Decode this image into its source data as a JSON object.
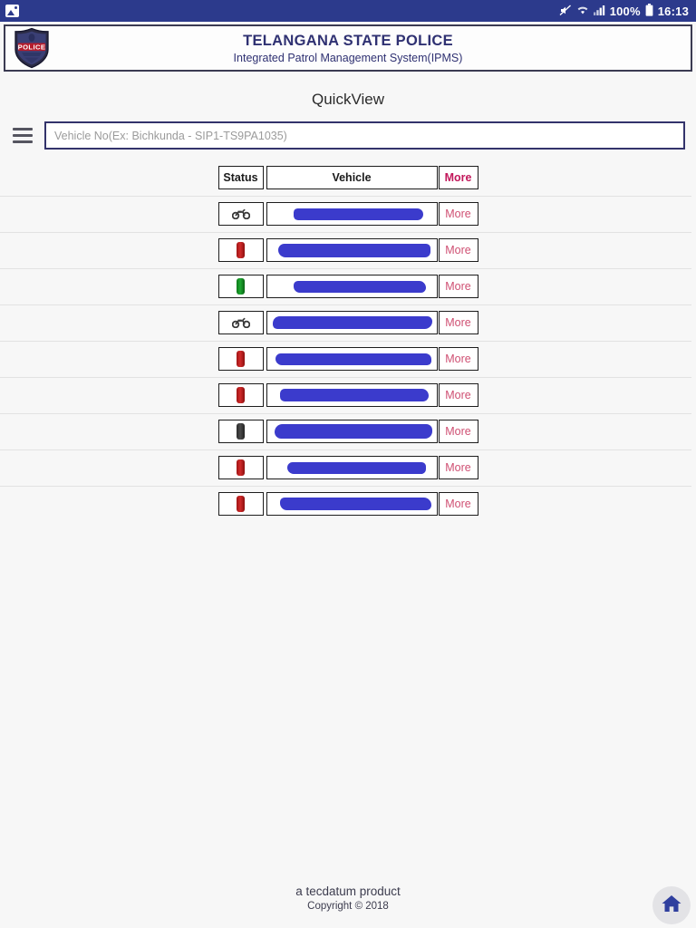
{
  "status_bar": {
    "left_icon": "image-icon",
    "mute_icon": "mute-icon",
    "wifi_icon": "wifi-icon",
    "signal_icon": "signal-icon",
    "battery_percent": "100%",
    "battery_icon": "battery-icon",
    "time": "16:13",
    "background_color": "#2c3a8c"
  },
  "header": {
    "logo": "police-badge-logo",
    "logo_text": "POLICE",
    "title": "TELANGANA STATE POLICE",
    "subtitle": "Integrated Patrol Management System(IPMS)",
    "title_color": "#2f3172"
  },
  "page": {
    "title": "QuickView"
  },
  "search": {
    "menu_icon": "hamburger-menu-icon",
    "value": "",
    "placeholder": "Vehicle No(Ex: Bichkunda - SIP1-TS9PA1035)",
    "border_color": "#33336b"
  },
  "table": {
    "columns": [
      "Status",
      "Vehicle",
      "More"
    ],
    "more_header_color": "#c2185b",
    "more_link_color": "#cf5073",
    "rows": [
      {
        "status_icon": "motorcycle-icon",
        "status_color": "#3a3a3a",
        "vehicle": "",
        "more_label": "More"
      },
      {
        "status_icon": "vehicle-red-icon",
        "status_color": "#d12a2a",
        "vehicle": "",
        "more_label": "More"
      },
      {
        "status_icon": "vehicle-green-icon",
        "status_color": "#1fa832",
        "vehicle": "",
        "more_label": "More"
      },
      {
        "status_icon": "motorcycle-icon",
        "status_color": "#3a3a3a",
        "vehicle": "",
        "more_label": "More"
      },
      {
        "status_icon": "vehicle-red-icon",
        "status_color": "#d12a2a",
        "vehicle": "",
        "more_label": "More"
      },
      {
        "status_icon": "vehicle-red-icon",
        "status_color": "#d12a2a",
        "vehicle": "",
        "more_label": "More"
      },
      {
        "status_icon": "vehicle-dark-icon",
        "status_color": "#4b4b4b",
        "vehicle": "",
        "more_label": "More"
      },
      {
        "status_icon": "vehicle-red-icon",
        "status_color": "#d12a2a",
        "vehicle": "",
        "more_label": "More"
      },
      {
        "status_icon": "vehicle-red-icon",
        "status_color": "#d12a2a",
        "vehicle": "",
        "more_label": "More"
      }
    ]
  },
  "footer": {
    "product": "a tecdatum product",
    "copyright": "Copyright © 2018"
  },
  "fab": {
    "icon": "home-icon",
    "color": "#2f3f9e"
  }
}
